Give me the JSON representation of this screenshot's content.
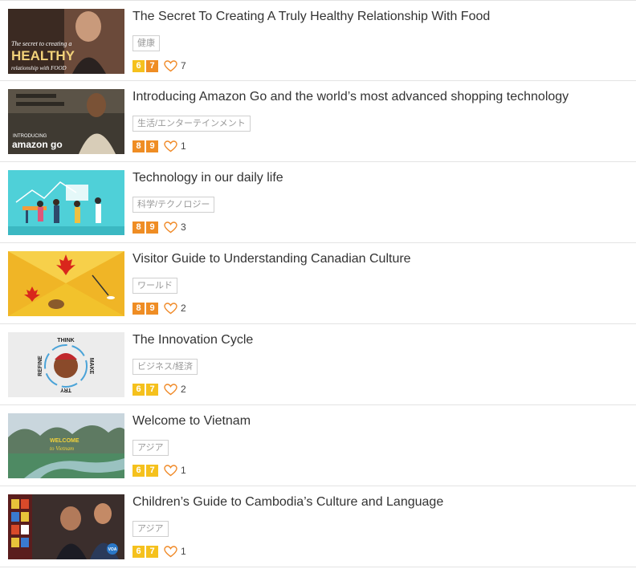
{
  "colors": {
    "level_low": "#f5c11d",
    "level_high": "#ef8d24",
    "heart": "#f08a28"
  },
  "items": [
    {
      "title": "The Secret To Creating A Truly Healthy Relationship With Food",
      "tag": "健康",
      "levels": [
        "6",
        "7"
      ],
      "likes": "7",
      "thumb_text": [
        "The secret to creating a",
        "HEALTHY",
        "relationship with FOOD"
      ]
    },
    {
      "title": "Introducing Amazon Go and the world’s most advanced shopping technology",
      "tag": "生活/エンターテインメント",
      "levels": [
        "8",
        "9"
      ],
      "likes": "1",
      "thumb_text": [
        "INTRODUCING",
        "amazon go"
      ]
    },
    {
      "title": "Technology in our daily life",
      "tag": "科学/テクノロジー",
      "levels": [
        "8",
        "9"
      ],
      "likes": "3",
      "thumb_text": []
    },
    {
      "title": "Visitor Guide to Understanding Canadian Culture",
      "tag": "ワールド",
      "levels": [
        "8",
        "9"
      ],
      "likes": "2",
      "thumb_text": []
    },
    {
      "title": "The Innovation Cycle",
      "tag": "ビジネス/経済",
      "levels": [
        "6",
        "7"
      ],
      "likes": "2",
      "thumb_text": [
        "THINK",
        "MAKE",
        "TRY",
        "REFINE"
      ]
    },
    {
      "title": "Welcome to Vietnam",
      "tag": "アジア",
      "levels": [
        "6",
        "7"
      ],
      "likes": "1",
      "thumb_text": [
        "WELCOME",
        "to Vietnam"
      ]
    },
    {
      "title": "Children’s Guide to Cambodia’s Culture and Language",
      "tag": "アジア",
      "levels": [
        "6",
        "7"
      ],
      "likes": "1",
      "thumb_text": [
        "VOA"
      ]
    }
  ]
}
